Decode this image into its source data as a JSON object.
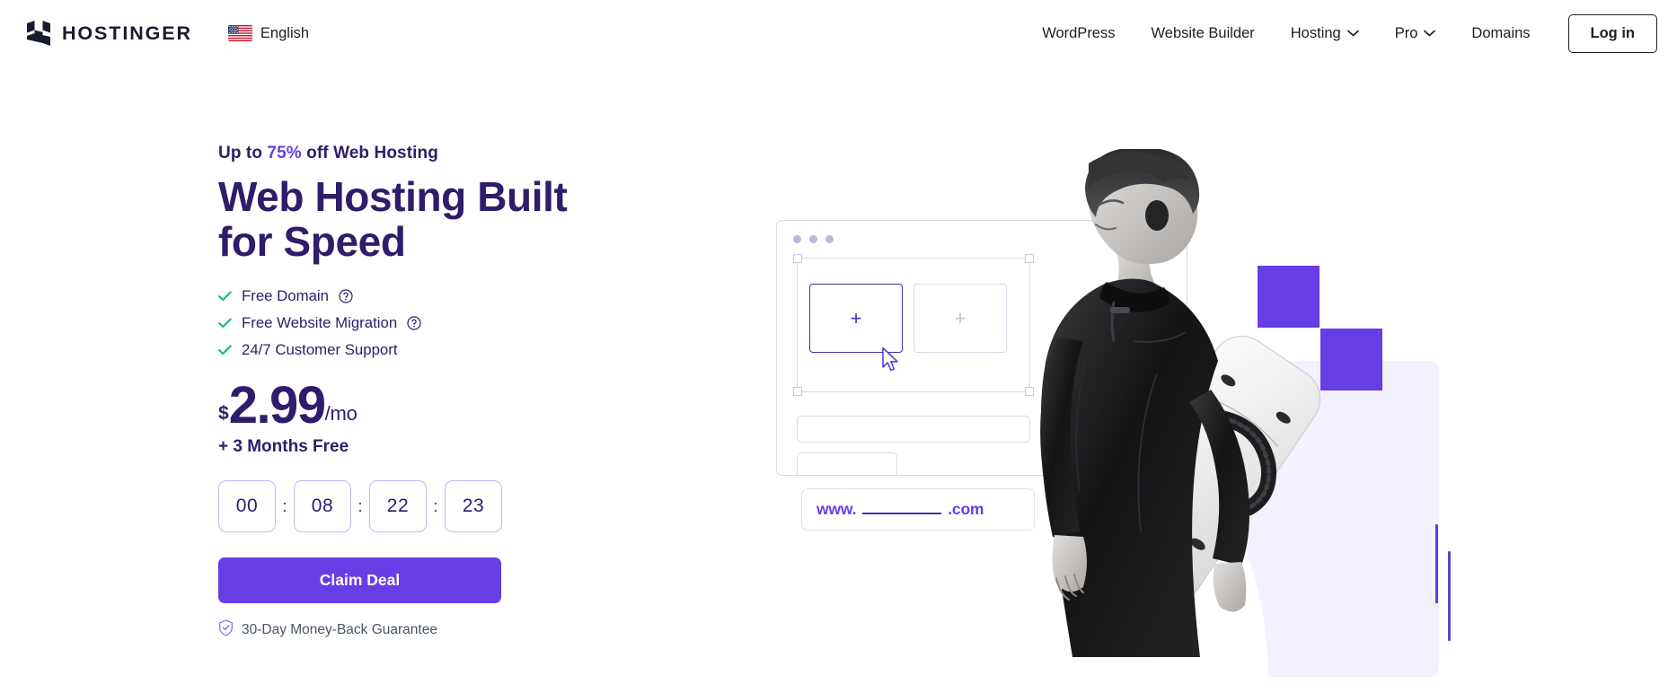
{
  "header": {
    "brand_name": "HOSTINGER",
    "logo_icon": "hostinger-h-logo",
    "language": {
      "label": "English",
      "flag_icon": "us-flag-icon"
    },
    "nav_items": [
      {
        "label": "WordPress",
        "has_dropdown": false
      },
      {
        "label": "Website Builder",
        "has_dropdown": false
      },
      {
        "label": "Hosting",
        "has_dropdown": true
      },
      {
        "label": "Pro",
        "has_dropdown": true
      },
      {
        "label": "Domains",
        "has_dropdown": false
      }
    ],
    "login_label": "Log in"
  },
  "hero": {
    "eyebrow_prefix": "Up to ",
    "eyebrow_percent": "75%",
    "eyebrow_suffix": " off Web Hosting",
    "headline": "Web Hosting Built for Speed",
    "features": [
      {
        "label": "Free Domain",
        "info": true,
        "check_icon": "check-icon",
        "info_icon": "question-circle-icon"
      },
      {
        "label": "Free Website Migration",
        "info": true,
        "check_icon": "check-icon",
        "info_icon": "question-circle-icon"
      },
      {
        "label": "24/7 Customer Support",
        "info": false,
        "check_icon": "check-icon"
      }
    ],
    "price": {
      "currency": "$",
      "amount": "2.99",
      "period": "/mo"
    },
    "bonus": "+ 3 Months Free",
    "countdown": {
      "values": [
        "00",
        "08",
        "22",
        "23"
      ],
      "separator": ":"
    },
    "cta_label": "Claim Deal",
    "guarantee": {
      "label": "30-Day Money-Back Guarantee",
      "icon": "shield-check-icon"
    }
  },
  "illustration": {
    "window_dots": [
      "dot-1",
      "dot-2",
      "dot-3"
    ],
    "placeholder_plus": "+",
    "placeholder_plus_secondary": "+",
    "cursor_icon": "mouse-pointer-icon",
    "domain_prefix": "www.",
    "domain_suffix": ".com",
    "photo_alt": "man-in-wetsuit-with-kiteboard"
  },
  "colors": {
    "brand_purple": "#673de6",
    "deep_purple": "#2f1c6a",
    "check_green": "#17b890",
    "lavender_panel": "#f3f1fe",
    "text_dark": "#1d1e20"
  }
}
